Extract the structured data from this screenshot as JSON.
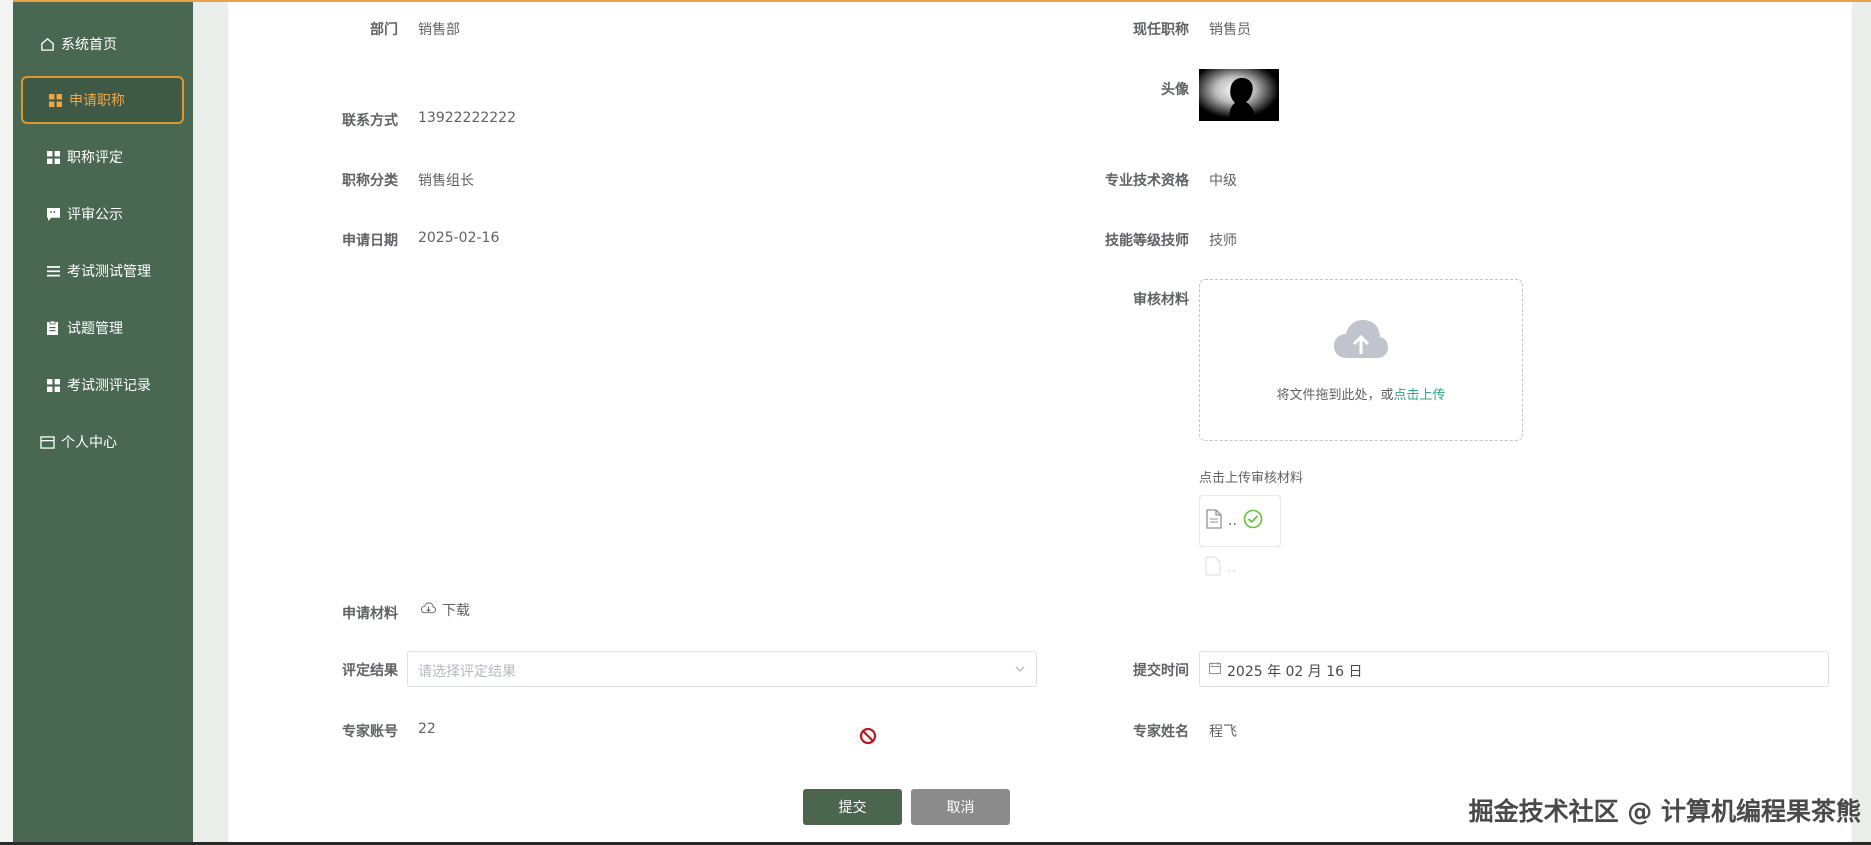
{
  "sidebar": {
    "items": [
      {
        "label": "系统首页",
        "icon": "home-icon"
      },
      {
        "label": "申请职称",
        "icon": "grid-icon",
        "active": true
      },
      {
        "label": "职称评定",
        "icon": "grid-icon"
      },
      {
        "label": "评审公示",
        "icon": "comment-icon"
      },
      {
        "label": "考试测试管理",
        "icon": "list-icon"
      },
      {
        "label": "试题管理",
        "icon": "clipboard-icon"
      },
      {
        "label": "考试测评记录",
        "icon": "grid-icon"
      },
      {
        "label": "个人中心",
        "icon": "card-icon"
      }
    ]
  },
  "form": {
    "department": {
      "label": "部门",
      "value": "销售部"
    },
    "current_title": {
      "label": "现任职称",
      "value": "销售员"
    },
    "avatar": {
      "label": "头像"
    },
    "contact": {
      "label": "联系方式",
      "value": "13922222222"
    },
    "title_category": {
      "label": "职称分类",
      "value": "销售组长"
    },
    "qualification": {
      "label": "专业技术资格",
      "value": "中级"
    },
    "apply_date": {
      "label": "申请日期",
      "value": "2025-02-16"
    },
    "skill_level": {
      "label": "技能等级技师",
      "value": "技师"
    },
    "review_material": {
      "label": "审核材料",
      "upload_text": "将文件拖到此处，或",
      "upload_link": "点击上传",
      "tip": "点击上传审核材料",
      "file_name": ".."
    },
    "apply_material": {
      "label": "申请材料",
      "download": "下载"
    },
    "result": {
      "label": "评定结果",
      "placeholder": "请选择评定结果"
    },
    "submit_time": {
      "label": "提交时间",
      "value": "2025 年 02 月 16 日"
    },
    "expert_account": {
      "label": "专家账号",
      "value": "22"
    },
    "expert_name": {
      "label": "专家姓名",
      "value": "程飞"
    }
  },
  "actions": {
    "submit": "提交",
    "cancel": "取消"
  },
  "watermark": "掘金技术社区 @ 计算机编程果茶熊",
  "colors": {
    "sidebar": "#4a6752",
    "accent": "#e0962d",
    "primary": "#4b654f",
    "link": "#2fa58c"
  }
}
